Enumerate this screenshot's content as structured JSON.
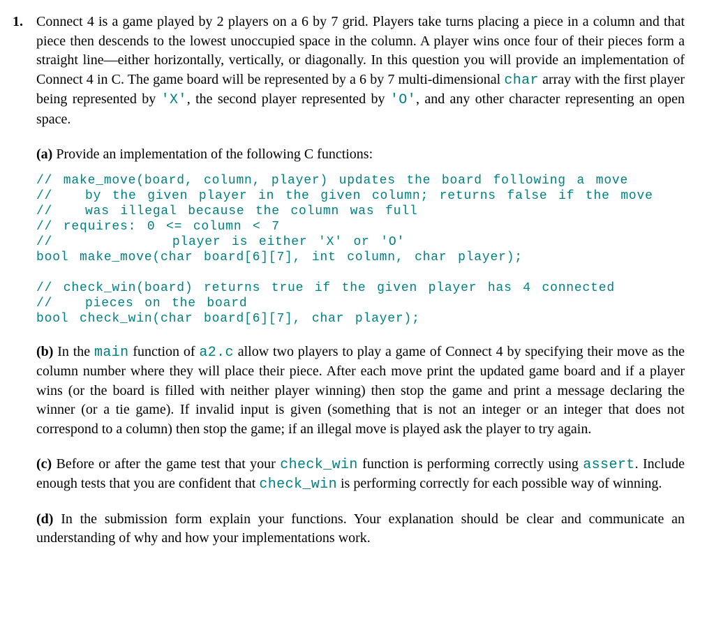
{
  "question_number": "1.",
  "intro": {
    "p1a": "Connect 4 is a game played by 2 players on a 6 by 7 grid. Players take turns placing a piece in a column and that piece then descends to the lowest unoccupied space in the column. A player wins once four of their pieces form a straight line—either horizontally, vertically, or diagonally. In this question you will provide an implementation of Connect 4 in C. The game board will be represented by a 6 by 7 multi-dimensional ",
    "code1": "char",
    "p1b": " array with the first player being represented by ",
    "code2": "'X'",
    "p1c": ", the second player represented by ",
    "code3": "'O'",
    "p1d": ", and any other character representing an open space."
  },
  "partA": {
    "label": "(a)",
    "text": " Provide an implementation of the following C functions:"
  },
  "code_block": "// make_move(board, column, player) updates the board following a move\n//   by the given player in the given column; returns false if the move\n//   was illegal because the column was full\n// requires: 0 <= column < 7\n//           player is either 'X' or 'O'\nbool make_move(char board[6][7], int column, char player);\n\n// check_win(board) returns true if the given player has 4 connected\n//   pieces on the board\nbool check_win(char board[6][7], char player);",
  "partB": {
    "label": "(b)",
    "t1": " In the ",
    "c1": "main",
    "t2": " function of ",
    "c2": "a2.c",
    "t3": " allow two players to play a game of Connect 4 by specifying their move as the column number where they will place their piece. After each move print the updated game board and if a player wins (or the board is filled with neither player winning) then stop the game and print a message declaring the winner (or a tie game). If invalid input is given (something that is not an integer or an integer that does not correspond to a column) then stop the game; if an illegal move is played ask the player to try again."
  },
  "partC": {
    "label": "(c)",
    "t1": " Before or after the game test that your ",
    "c1": "check_win",
    "t2": " function is performing correctly using ",
    "c2": "assert",
    "t3": ". Include enough tests that you are confident that ",
    "c3": "check_win",
    "t4": " is performing correctly for each possible way of winning."
  },
  "partD": {
    "label": "(d)",
    "text": " In the submission form explain your functions. Your explanation should be clear and communicate an understanding of why and how your implementations work."
  }
}
